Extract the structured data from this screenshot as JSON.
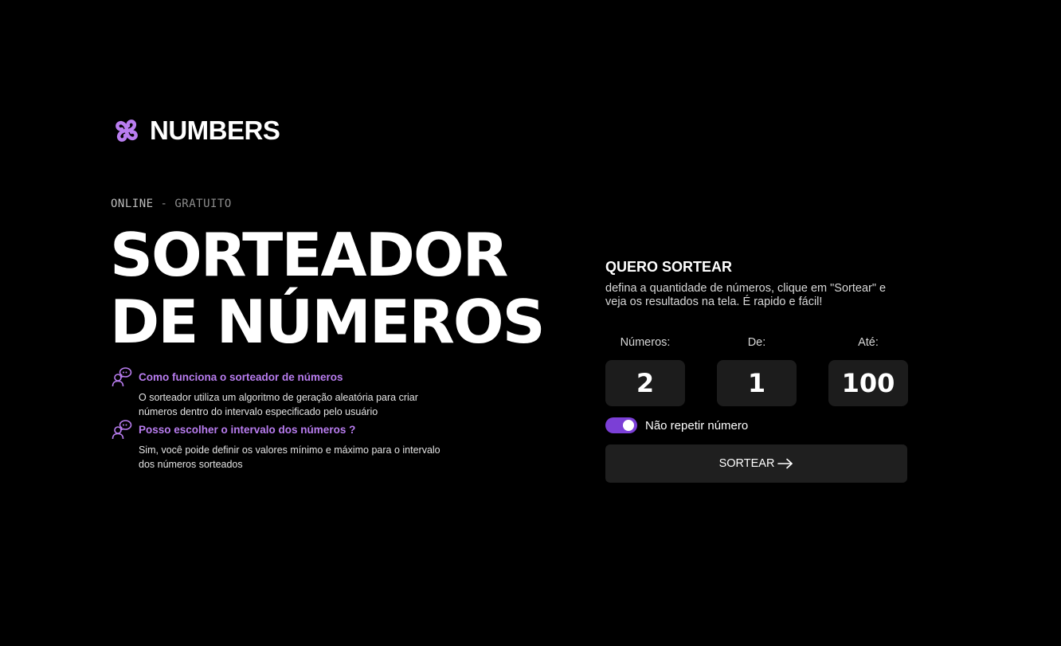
{
  "brand": {
    "name": "NUMBERS",
    "icon": "numbers-logo-icon",
    "accent_color": "#b97df0"
  },
  "hero": {
    "kicker_primary": "ONLINE",
    "kicker_separator": " - ",
    "kicker_secondary": "GRATUITO",
    "headline_line1": "SORTEADOR",
    "headline_line2": "DE NÚMEROS"
  },
  "faq": [
    {
      "icon": "chat-people-icon",
      "title": "Como funciona o sorteador de números",
      "body": "O sorteador utiliza um algoritmo de geração aleatória para criar números dentro do intervalo especificado pelo usuário"
    },
    {
      "icon": "chat-people-icon",
      "title": "Posso escolher o intervalo dos números ?",
      "body": "Sim, você poide definir os valores mínimo e máximo para o intervalo dos números sorteados"
    }
  ],
  "form": {
    "title": "QUERO SORTEAR",
    "description": "defina a quantidade de números, clique em \"Sortear\" e veja os resultados na tela. É rapido e fácil!",
    "fields": [
      {
        "label": "Números:",
        "value": "2"
      },
      {
        "label": "De:",
        "value": "1"
      },
      {
        "label": "Até:",
        "value": "100"
      }
    ],
    "no_repeat_label": "Não repetir número",
    "no_repeat_enabled": true,
    "toggle_color": "#7b3fd6",
    "submit_label": "SORTEAR",
    "submit_icon": "arrow-right-icon"
  }
}
